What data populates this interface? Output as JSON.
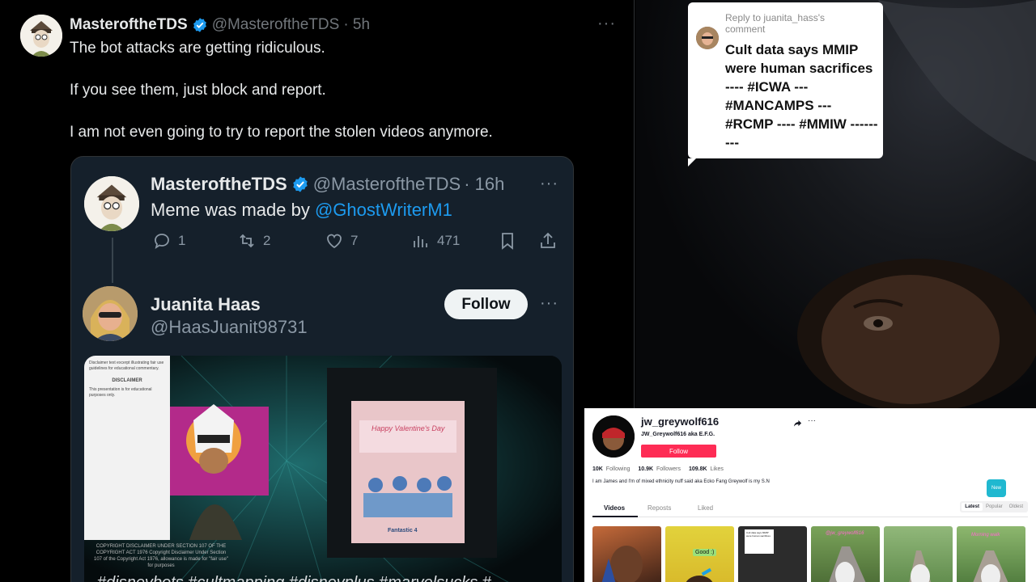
{
  "tweet": {
    "author_name": "MasteroftheTDS",
    "author_handle": "@MasteroftheTDS",
    "time": "· 5h",
    "lines": [
      "The bot attacks are getting ridiculous.",
      "If you see them, just block and report.",
      "I am not even going to try to report the stolen videos anymore."
    ],
    "more": "···"
  },
  "quote": {
    "author_name": "MasteroftheTDS",
    "author_handle": "@MasteroftheTDS",
    "time": "· 16h",
    "text_prefix": "Meme was made by ",
    "mention": "@GhostWriterM1",
    "more": "···",
    "actions": {
      "replies": "1",
      "reposts": "2",
      "likes": "7",
      "views": "471"
    },
    "reply_author_name": "Juanita Haas",
    "reply_author_handle": "@HaasJuanit98731",
    "follow_label": "Follow",
    "media": {
      "doc_heading": "DISCLAIMER",
      "copyright_text": "COPYRIGHT DISCLAIMER UNDER SECTION 107 OF THE COPYRIGHT ACT 1976 Copyright Disclaimer Under Section 107 of the Copyright Act 1976, allowance is made for \"fair use\" for purposes",
      "poster_title": "Happy Valentine's Day",
      "poster_sub": "Fantastic 4",
      "hashtags": "#disneybots #cultmapping #disneyplus #marvelsucks #"
    }
  },
  "video": {
    "reply_to": "Reply to juanita_hass's comment",
    "comment": "Cult data says MMIP were human sacrifices ---- #ICWA --- #MANCAMPS --- #RCMP ---- #MMIW ---------"
  },
  "profile": {
    "username": "jw_greywolf616",
    "nickname": "JW_Greywolf616 aka E.F.G.",
    "follow_label": "Follow",
    "stats": [
      {
        "value": "10K",
        "label": "Following"
      },
      {
        "value": "10.9K",
        "label": "Followers"
      },
      {
        "value": "109.8K",
        "label": "Likes"
      }
    ],
    "bio": "I am James and I'm of mixed ethnicity nuff said aka Ecko Fang Greywolf is my S.N",
    "tabs": [
      "Videos",
      "Reposts",
      "Liked"
    ],
    "sort": [
      "Latest",
      "Popular",
      "Oldest"
    ],
    "new_label": "New",
    "thumb_labels": [
      "Good :)",
      "@jw_greywolf616",
      "Morning walk"
    ]
  },
  "colors": {
    "link": "#1d9bf0",
    "verified": "#1d9bf0",
    "tiktok_red": "#fe2c55",
    "card_bg": "#15202b"
  }
}
